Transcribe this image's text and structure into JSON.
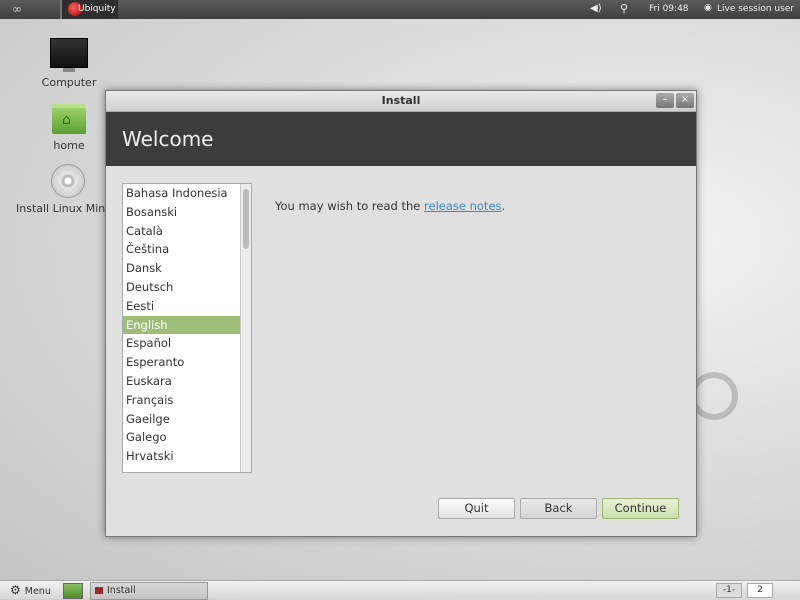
{
  "top_panel": {
    "app_label": "Ubiquity",
    "clock": "Fri 09:48",
    "user": "Live session user"
  },
  "desktop": {
    "icons": [
      {
        "label": "Computer",
        "icon": "monitor-icon"
      },
      {
        "label": "home",
        "icon": "home-folder-icon"
      },
      {
        "label": "Install Linux Mint",
        "icon": "disc-icon"
      }
    ]
  },
  "window": {
    "title": "Install",
    "minimize": "–",
    "close": "×",
    "banner_title": "Welcome",
    "languages": [
      "Bahasa Indonesia",
      "Bosanski",
      "Català",
      "Čeština",
      "Dansk",
      "Deutsch",
      "Eesti",
      "English",
      "Español",
      "Esperanto",
      "Euskara",
      "Français",
      "Gaeilge",
      "Galego",
      "Hrvatski"
    ],
    "selected_language": "English",
    "notes_prefix": "You may wish to read the ",
    "notes_link": "release notes",
    "notes_suffix": ".",
    "buttons": {
      "quit": "Quit",
      "back": "Back",
      "continue": "Continue"
    }
  },
  "bottom_panel": {
    "menu_label": "Menu",
    "task_label": "Install",
    "workspaces": [
      "-1-",
      "2"
    ]
  },
  "colors": {
    "banner": "#3c3c3c",
    "selection": "#9ebe78",
    "link": "#3a87c8"
  }
}
